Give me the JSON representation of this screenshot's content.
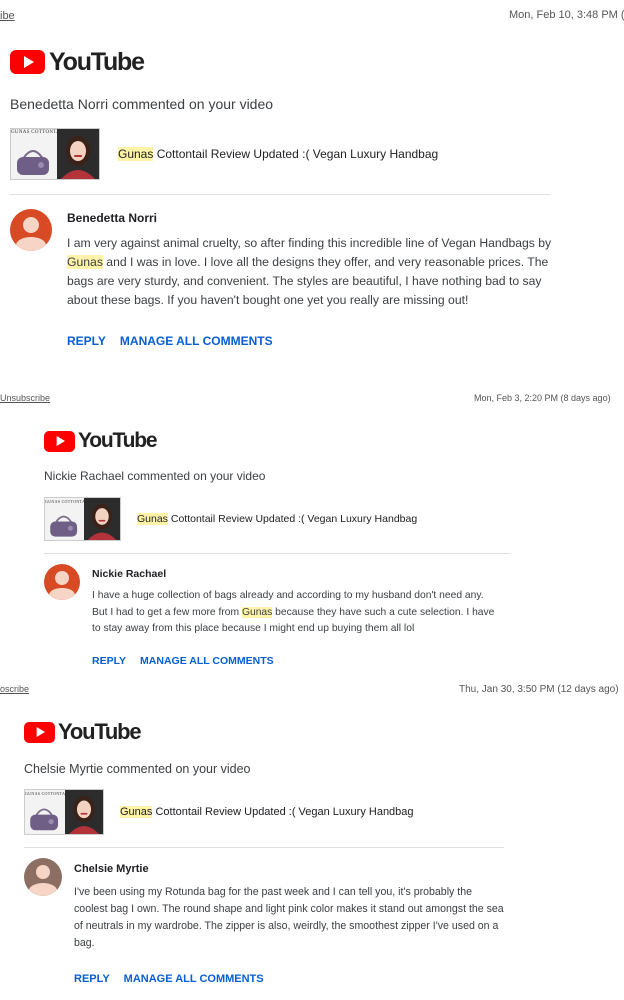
{
  "emails": [
    {
      "unsubscribe_label": "ibe",
      "date": "Mon, Feb 10, 3:48 PM (",
      "logo_text": "YouTube",
      "headline": "Benedetta Norri commented on your video",
      "thumb_brand": "GUNAS COTTONTAIL",
      "video_title_highlight": "Gunas",
      "video_title_rest": " Cottontail Review Updated :( Vegan Luxury Handbag",
      "author": "Benedetta Norri",
      "comment_part1": "I am very against animal cruelty, so after finding this incredible line of Vegan Handbags by ",
      "comment_highlight": "Gunas",
      "comment_part2": " and I was in love. I love all the designs they offer, and very reasonable prices. The bags are very sturdy, and convenient. The styles are beautiful, I have nothing bad to say about these bags. If you haven't bought one yet you really are missing out!",
      "reply_label": "REPLY",
      "manage_label": "MANAGE ALL COMMENTS",
      "avatar_color": "#d74a23"
    },
    {
      "unsubscribe_label": "Unsubscribe",
      "date": "Mon, Feb 3, 2:20 PM (8 days ago)",
      "logo_text": "YouTube",
      "headline": "Nickie Rachael commented on your video",
      "thumb_brand": "GUNAS COTTONTAIL",
      "video_title_highlight": "Gunas",
      "video_title_rest": " Cottontail Review Updated :( Vegan Luxury Handbag",
      "author": "Nickie Rachael",
      "comment_part1": "I have a huge collection of bags already and according to my husband don't need any. But I had to get a few more from ",
      "comment_highlight": "Gunas",
      "comment_part2": " because they have such a cute selection. I have to stay away from this place because I might end up buying them all lol",
      "reply_label": "REPLY",
      "manage_label": "MANAGE ALL COMMENTS",
      "avatar_color": "#d74a23"
    },
    {
      "unsubscribe_label": "oscribe",
      "date": "Thu, Jan 30, 3:50 PM (12 days ago)",
      "logo_text": "YouTube",
      "headline": "Chelsie Myrtie commented on your video",
      "thumb_brand": "GUNAS COTTONTAIL",
      "video_title_highlight": "Gunas",
      "video_title_rest": " Cottontail Review Updated :( Vegan Luxury Handbag",
      "author": "Chelsie Myrtie",
      "comment_part1": "I've been using my Rotunda bag for the past week and I can tell you, it's probably the coolest bag I own. The round shape and light pink color makes it stand out amongst the sea of neutrals in my wardrobe. The zipper is also, weirdly, the smoothest zipper I've used on a bag.",
      "comment_highlight": "",
      "comment_part2": "",
      "reply_label": "REPLY",
      "manage_label": "MANAGE ALL COMMENTS",
      "avatar_color": "#8d6e63"
    }
  ],
  "colors": {
    "youtube_red": "#ff0000",
    "link_blue": "#065fd4",
    "highlight": "#fff3a8"
  },
  "icons": {
    "logo": "youtube-play-icon",
    "avatar": "person-avatar-icon",
    "thumbnail": "video-thumbnail"
  }
}
